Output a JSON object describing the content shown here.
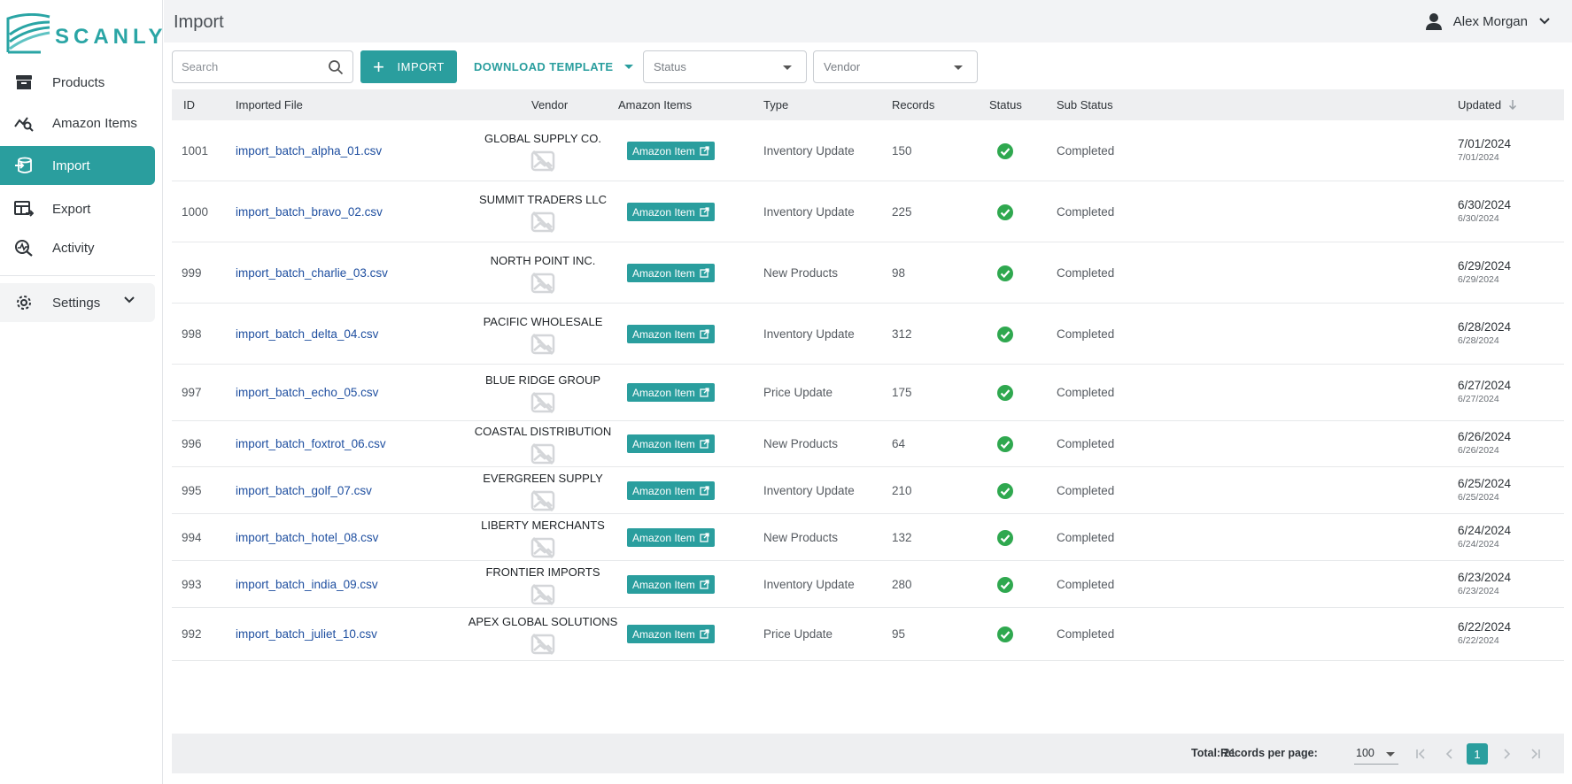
{
  "app": {
    "logo_text": "SCANLY"
  },
  "header": {
    "title": "Import",
    "user_name": "Alex Morgan"
  },
  "sidebar": {
    "items": [
      {
        "label": "Products",
        "icon": "archive-box-icon"
      },
      {
        "label": "Amazon Items",
        "icon": "trend-search-icon"
      },
      {
        "label": "Import",
        "icon": "import-icon",
        "active": true
      },
      {
        "label": "Export",
        "icon": "table-export-icon"
      },
      {
        "label": "Activity",
        "icon": "activity-search-icon"
      }
    ],
    "settings_label": "Settings"
  },
  "toolbar": {
    "search_placeholder": "Search",
    "import_label": "IMPORT",
    "template_label": "DOWNLOAD TEMPLATE",
    "status_placeholder": "Status",
    "vendor_placeholder": "Vendor"
  },
  "table": {
    "columns": {
      "id": "ID",
      "file": "Imported File",
      "vendor": "Vendor",
      "amazon": "Amazon Items",
      "type": "Type",
      "records": "Records",
      "status": "Status",
      "sub_status": "Sub Status",
      "updated": "Updated"
    },
    "amazon_label": "Amazon Item",
    "rows": [
      {
        "id": "1001",
        "file": "import_batch_alpha_01.csv",
        "vendor": "GLOBAL SUPPLY CO.",
        "type": "Inventory Update",
        "records": "150",
        "sub_status": "Completed",
        "updated": "7/01/2024",
        "updated_sub": "7/01/2024"
      },
      {
        "id": "1000",
        "file": "import_batch_bravo_02.csv",
        "vendor": "SUMMIT TRADERS LLC",
        "type": "Inventory Update",
        "records": "225",
        "sub_status": "Completed",
        "updated": "6/30/2024",
        "updated_sub": "6/30/2024"
      },
      {
        "id": "999",
        "file": "import_batch_charlie_03.csv",
        "vendor": "NORTH POINT INC.",
        "type": "New Products",
        "records": "98",
        "sub_status": "Completed",
        "updated": "6/29/2024",
        "updated_sub": "6/29/2024"
      },
      {
        "id": "998",
        "file": "import_batch_delta_04.csv",
        "vendor": "PACIFIC WHOLESALE",
        "type": "Inventory Update",
        "records": "312",
        "sub_status": "Completed",
        "updated": "6/28/2024",
        "updated_sub": "6/28/2024"
      },
      {
        "id": "997",
        "file": "import_batch_echo_05.csv",
        "vendor": "BLUE RIDGE GROUP",
        "type": "Price Update",
        "records": "175",
        "sub_status": "Completed",
        "updated": "6/27/2024",
        "updated_sub": "6/27/2024"
      },
      {
        "id": "996",
        "file": "import_batch_foxtrot_06.csv",
        "vendor": "COASTAL DISTRIBUTION",
        "type": "New Products",
        "records": "64",
        "sub_status": "Completed",
        "updated": "6/26/2024",
        "updated_sub": "6/26/2024"
      },
      {
        "id": "995",
        "file": "import_batch_golf_07.csv",
        "vendor": "EVERGREEN SUPPLY",
        "type": "Inventory Update",
        "records": "210",
        "sub_status": "Completed",
        "updated": "6/25/2024",
        "updated_sub": "6/25/2024"
      },
      {
        "id": "994",
        "file": "import_batch_hotel_08.csv",
        "vendor": "LIBERTY MERCHANTS",
        "type": "New Products",
        "records": "132",
        "sub_status": "Completed",
        "updated": "6/24/2024",
        "updated_sub": "6/24/2024"
      },
      {
        "id": "993",
        "file": "import_batch_india_09.csv",
        "vendor": "FRONTIER IMPORTS",
        "type": "Inventory Update",
        "records": "280",
        "sub_status": "Completed",
        "updated": "6/23/2024",
        "updated_sub": "6/23/2024"
      },
      {
        "id": "992",
        "file": "import_batch_juliet_10.csv",
        "vendor": "APEX GLOBAL SOLUTIONS",
        "type": "Price Update",
        "records": "95",
        "sub_status": "Completed",
        "updated": "6/22/2024",
        "updated_sub": "6/22/2024"
      }
    ]
  },
  "footer": {
    "total_label": "Total:",
    "total_value": "21",
    "rpp_label": "Records per page:",
    "rpp_value": "100",
    "current_page": "1"
  },
  "colors": {
    "accent": "#2a9e9e",
    "link": "#1f4fa0",
    "success": "#2fa84f"
  }
}
